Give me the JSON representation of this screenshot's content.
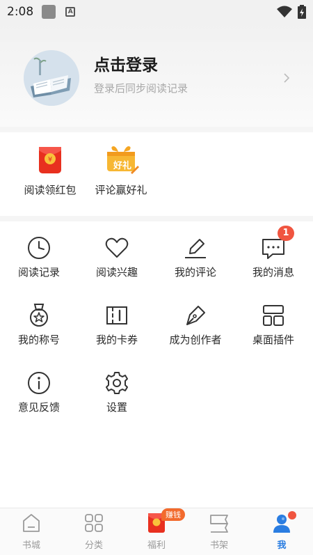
{
  "status": {
    "time": "2:08"
  },
  "profile": {
    "login_title": "点击登录",
    "login_sub": "登录后同步阅读记录"
  },
  "rewards": [
    {
      "label": "阅读领红包",
      "icon": "red-envelope-icon"
    },
    {
      "label": "评论赢好礼",
      "icon": "gift-box-icon",
      "icon_text": "好礼"
    }
  ],
  "menu": [
    {
      "label": "阅读记录",
      "icon": "clock-icon"
    },
    {
      "label": "阅读兴趣",
      "icon": "heart-icon"
    },
    {
      "label": "我的评论",
      "icon": "pencil-icon"
    },
    {
      "label": "我的消息",
      "icon": "message-icon",
      "badge": "1"
    },
    {
      "label": "我的称号",
      "icon": "medal-icon"
    },
    {
      "label": "我的卡券",
      "icon": "ticket-icon"
    },
    {
      "label": "成为创作者",
      "icon": "pen-nib-icon"
    },
    {
      "label": "桌面插件",
      "icon": "widget-icon"
    },
    {
      "label": "意见反馈",
      "icon": "info-icon"
    },
    {
      "label": "设置",
      "icon": "gear-icon"
    }
  ],
  "tabbar": {
    "tabs": [
      {
        "label": "书城",
        "icon": "house-icon"
      },
      {
        "label": "分类",
        "icon": "grid-icon"
      },
      {
        "label": "福利",
        "icon": "red-envelope-icon",
        "badge": "赚钱"
      },
      {
        "label": "书架",
        "icon": "bookshelf-icon"
      },
      {
        "label": "我",
        "icon": "user-icon",
        "active": true
      }
    ]
  },
  "colors": {
    "accent": "#2a7de1",
    "badge": "#f05540",
    "earn": "#f26a2d"
  }
}
